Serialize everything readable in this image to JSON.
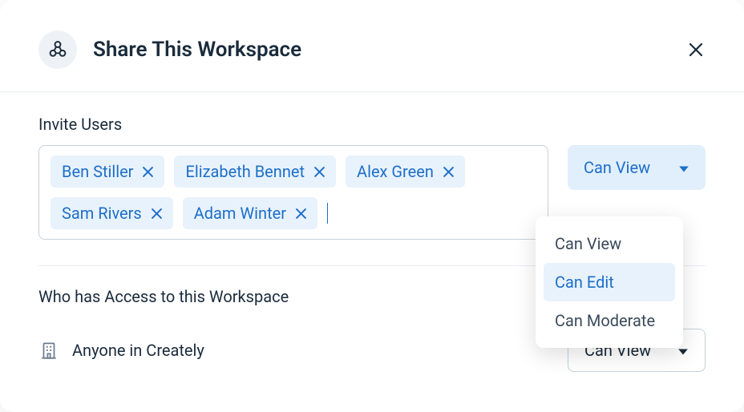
{
  "header": {
    "title": "Share This Workspace"
  },
  "invite": {
    "label": "Invite Users",
    "chips": [
      {
        "name": "Ben Stiller"
      },
      {
        "name": "Elizabeth Bennet"
      },
      {
        "name": "Alex Green"
      },
      {
        "name": "Sam Rivers"
      },
      {
        "name": "Adam Winter"
      }
    ],
    "permission_selected": "Can View",
    "permission_options": [
      {
        "label": "Can View",
        "active": false
      },
      {
        "label": "Can Edit",
        "active": true
      },
      {
        "label": "Can Moderate",
        "active": false
      }
    ]
  },
  "access": {
    "title": "Who has Access to this Workspace",
    "org_label": "Anyone in Creately",
    "org_permission": "Can View"
  },
  "colors": {
    "accent": "#1d6fc9",
    "chip_bg": "#e8f2fc",
    "text": "#1a2b3c",
    "border": "#c5d0db"
  }
}
